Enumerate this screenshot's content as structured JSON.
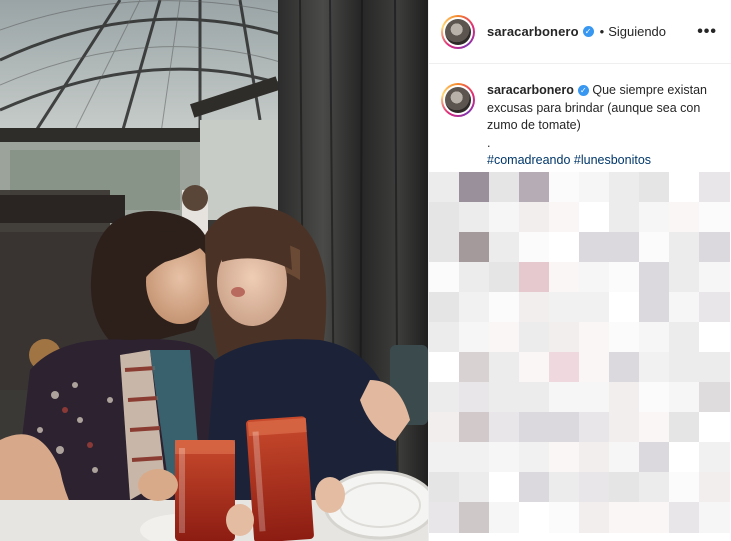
{
  "post": {
    "username": "saracarbonero",
    "verified_icon": "verified-badge-icon",
    "separator": "•",
    "follow_status": "Siguiendo",
    "more_options": "•••"
  },
  "caption": {
    "username": "saracarbonero",
    "text_line1": "Que siempre existan excusas para brindar (aunque sea con zumo de tomate)",
    "dot": ".",
    "hashtags": [
      "#comadreando",
      "#lunesbonitos"
    ]
  },
  "comments": {
    "state": "pixelated"
  },
  "colors": {
    "accent": "#3897f0",
    "hashtag": "#00376b",
    "border": "#efefef"
  }
}
